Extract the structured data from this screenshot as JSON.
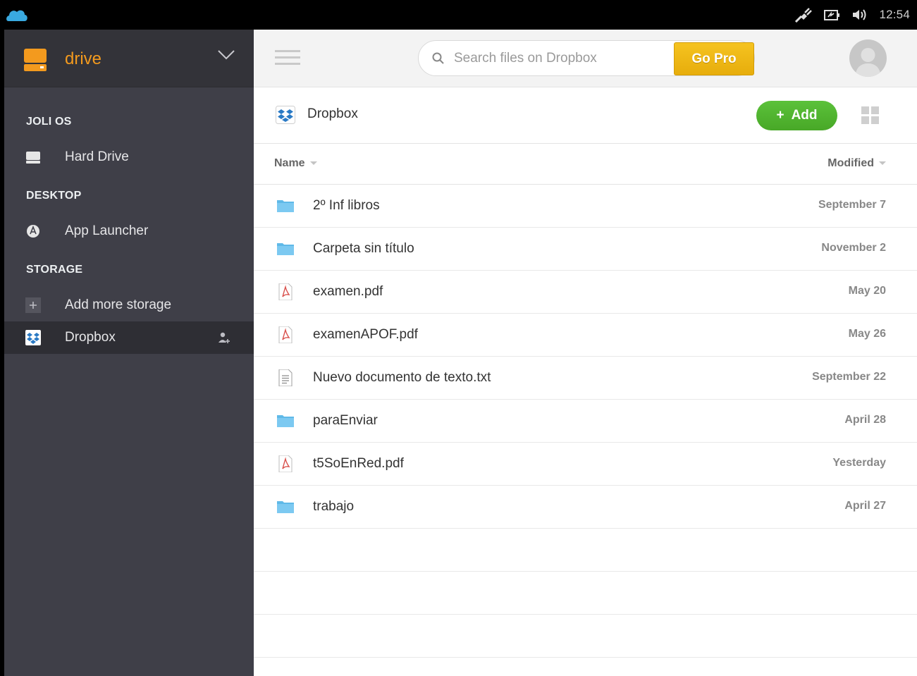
{
  "system": {
    "clock": "12:54"
  },
  "sidebar": {
    "app_title": "drive",
    "sections": [
      {
        "title": "JOLI OS",
        "items": [
          {
            "label": "Hard Drive",
            "icon": "hard-drive-icon"
          }
        ]
      },
      {
        "title": "DESKTOP",
        "items": [
          {
            "label": "App Launcher",
            "icon": "app-launcher-icon"
          }
        ]
      },
      {
        "title": "STORAGE",
        "items": [
          {
            "label": "Add more storage",
            "icon": "plus-icon"
          },
          {
            "label": "Dropbox",
            "icon": "dropbox-icon",
            "active": true
          }
        ]
      }
    ]
  },
  "topbar": {
    "search_placeholder": "Search files on Dropbox",
    "gopro_label": "Go Pro"
  },
  "breadcrumb": {
    "current": "Dropbox"
  },
  "toolbar": {
    "add_label": "Add"
  },
  "table": {
    "col_name": "Name",
    "col_modified": "Modified",
    "rows": [
      {
        "name": "2º Inf libros",
        "modified": "September 7",
        "type": "folder"
      },
      {
        "name": "Carpeta sin título",
        "modified": "November 2",
        "type": "folder"
      },
      {
        "name": "examen.pdf",
        "modified": "May 20",
        "type": "pdf"
      },
      {
        "name": "examenAPOF.pdf",
        "modified": "May 26",
        "type": "pdf"
      },
      {
        "name": "Nuevo documento de texto.txt",
        "modified": "September 22",
        "type": "txt"
      },
      {
        "name": "paraEnviar",
        "modified": "April 28",
        "type": "folder"
      },
      {
        "name": "t5SoEnRed.pdf",
        "modified": "Yesterday",
        "type": "pdf"
      },
      {
        "name": "trabajo",
        "modified": "April 27",
        "type": "folder"
      }
    ]
  },
  "colors": {
    "accent_orange": "#f39a1e",
    "add_green": "#52b531",
    "gopro_yellow": "#eeb515",
    "folder_blue": "#5fb9e8",
    "pdf_red": "#d9534f"
  }
}
